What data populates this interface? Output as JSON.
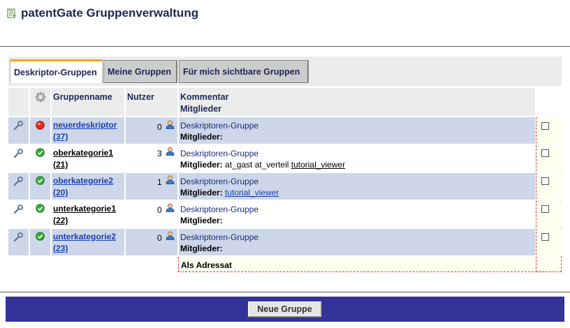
{
  "title": "patentGate Gruppenverwaltung",
  "tabs": [
    {
      "label": "Deskriptor-Gruppen",
      "active": true
    },
    {
      "label": "Meine Gruppen",
      "active": false
    },
    {
      "label": "Für mich sichtbare Gruppen",
      "active": false
    }
  ],
  "table": {
    "headers": {
      "name": "Gruppenname",
      "users": "Nutzer",
      "comment": "Kommentar",
      "members": "Mitglieder"
    },
    "rows": [
      {
        "status": "red",
        "name": "neuerdeskriptor",
        "id": "(37)",
        "users": "0",
        "comment": "Deskriptoren-Gruppe",
        "members_label": "Mitglieder:",
        "members_plain": "",
        "members_link": ""
      },
      {
        "status": "green",
        "name": "oberkategorie1",
        "id": "(21)",
        "users": "3",
        "comment": "Deskriptoren-Gruppe",
        "members_label": "Mitglieder:",
        "members_plain": "at_gast at_verteil",
        "members_link": "tutorial_viewer"
      },
      {
        "status": "green",
        "name": "oberkategorie2",
        "id": "(20)",
        "users": "1",
        "comment": "Deskriptoren-Gruppe",
        "members_label": "Mitglieder:",
        "members_plain": "",
        "members_link": "tutorial_viewer"
      },
      {
        "status": "green",
        "name": "unterkategorie1",
        "id": "(22)",
        "users": "0",
        "comment": "Deskriptoren-Gruppe",
        "members_label": "Mitglieder:",
        "members_plain": "",
        "members_link": ""
      },
      {
        "status": "green",
        "name": "unterkategorie2",
        "id": "(23)",
        "users": "0",
        "comment": "Deskriptoren-Gruppe",
        "members_label": "Mitglieder:",
        "members_plain": "",
        "members_link": ""
      }
    ]
  },
  "addressee_label": "Als Adressat",
  "new_group_button": "Neue Gruppe",
  "colors": {
    "title": "#1d2756",
    "tab_accent": "#f5a623",
    "row_alt": "#cdd7e9",
    "footer": "#333399",
    "link": "#1a3fb0"
  }
}
